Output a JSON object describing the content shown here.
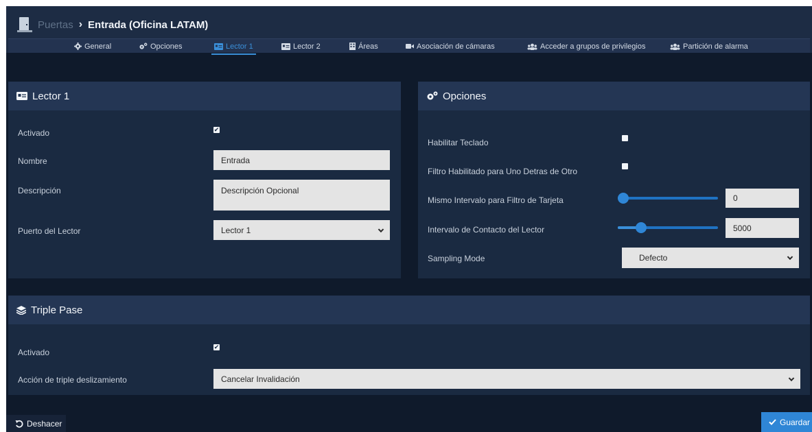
{
  "header": {
    "breadcrumb_parent": "Puertas",
    "breadcrumb_sep": "›",
    "breadcrumb_current": "Entrada (Oficina LATAM)",
    "icon": "door-icon"
  },
  "tabs": [
    {
      "label": "General",
      "icon": "gear-icon"
    },
    {
      "label": "Opciones",
      "icon": "gears-icon"
    },
    {
      "label": "Lector 1",
      "icon": "card-reader-icon",
      "active": true
    },
    {
      "label": "Lector 2",
      "icon": "card-reader-icon"
    },
    {
      "label": "Áreas",
      "icon": "building-icon"
    },
    {
      "label": "Asociación de cámaras",
      "icon": "video-camera-icon"
    },
    {
      "label": "Acceder a grupos de privilegios",
      "icon": "users-icon"
    },
    {
      "label": "Partición de alarma",
      "icon": "users-icon"
    }
  ],
  "lector": {
    "title": "Lector 1",
    "activado_label": "Activado",
    "activado_checked": true,
    "nombre_label": "Nombre",
    "nombre_value": "Entrada",
    "descripcion_label": "Descripción",
    "descripcion_value": "Descripción Opcional",
    "puerto_label": "Puerto del Lector",
    "puerto_value": "Lector 1"
  },
  "opciones": {
    "title": "Opciones",
    "teclado_label": "Habilitar Teclado",
    "teclado_checked": false,
    "filtro_label": "Filtro Habilitado para Uno Detras de Otro",
    "filtro_checked": false,
    "mismo_label": "Mismo Intervalo para Filtro de Tarjeta",
    "mismo_value": "0",
    "mismo_slider_fraction": 0.0,
    "contacto_label": "Intervalo de Contacto del Lector",
    "contacto_value": "5000",
    "contacto_slider_fraction": 0.2,
    "sampling_label": "Sampling Mode",
    "sampling_value": "Defecto"
  },
  "triple": {
    "title": "Triple Pase",
    "activado_label": "Activado",
    "activado_checked": true,
    "accion_label": "Acción de triple deslizamiento",
    "accion_value": "Cancelar Invalidación"
  },
  "footer": {
    "undo_label": "Deshacer",
    "save_label": "Guardar"
  },
  "colors": {
    "background": "#0f1a2b",
    "panel": "#1a2a41",
    "panel_header": "#243654",
    "accent": "#2f86d6"
  }
}
